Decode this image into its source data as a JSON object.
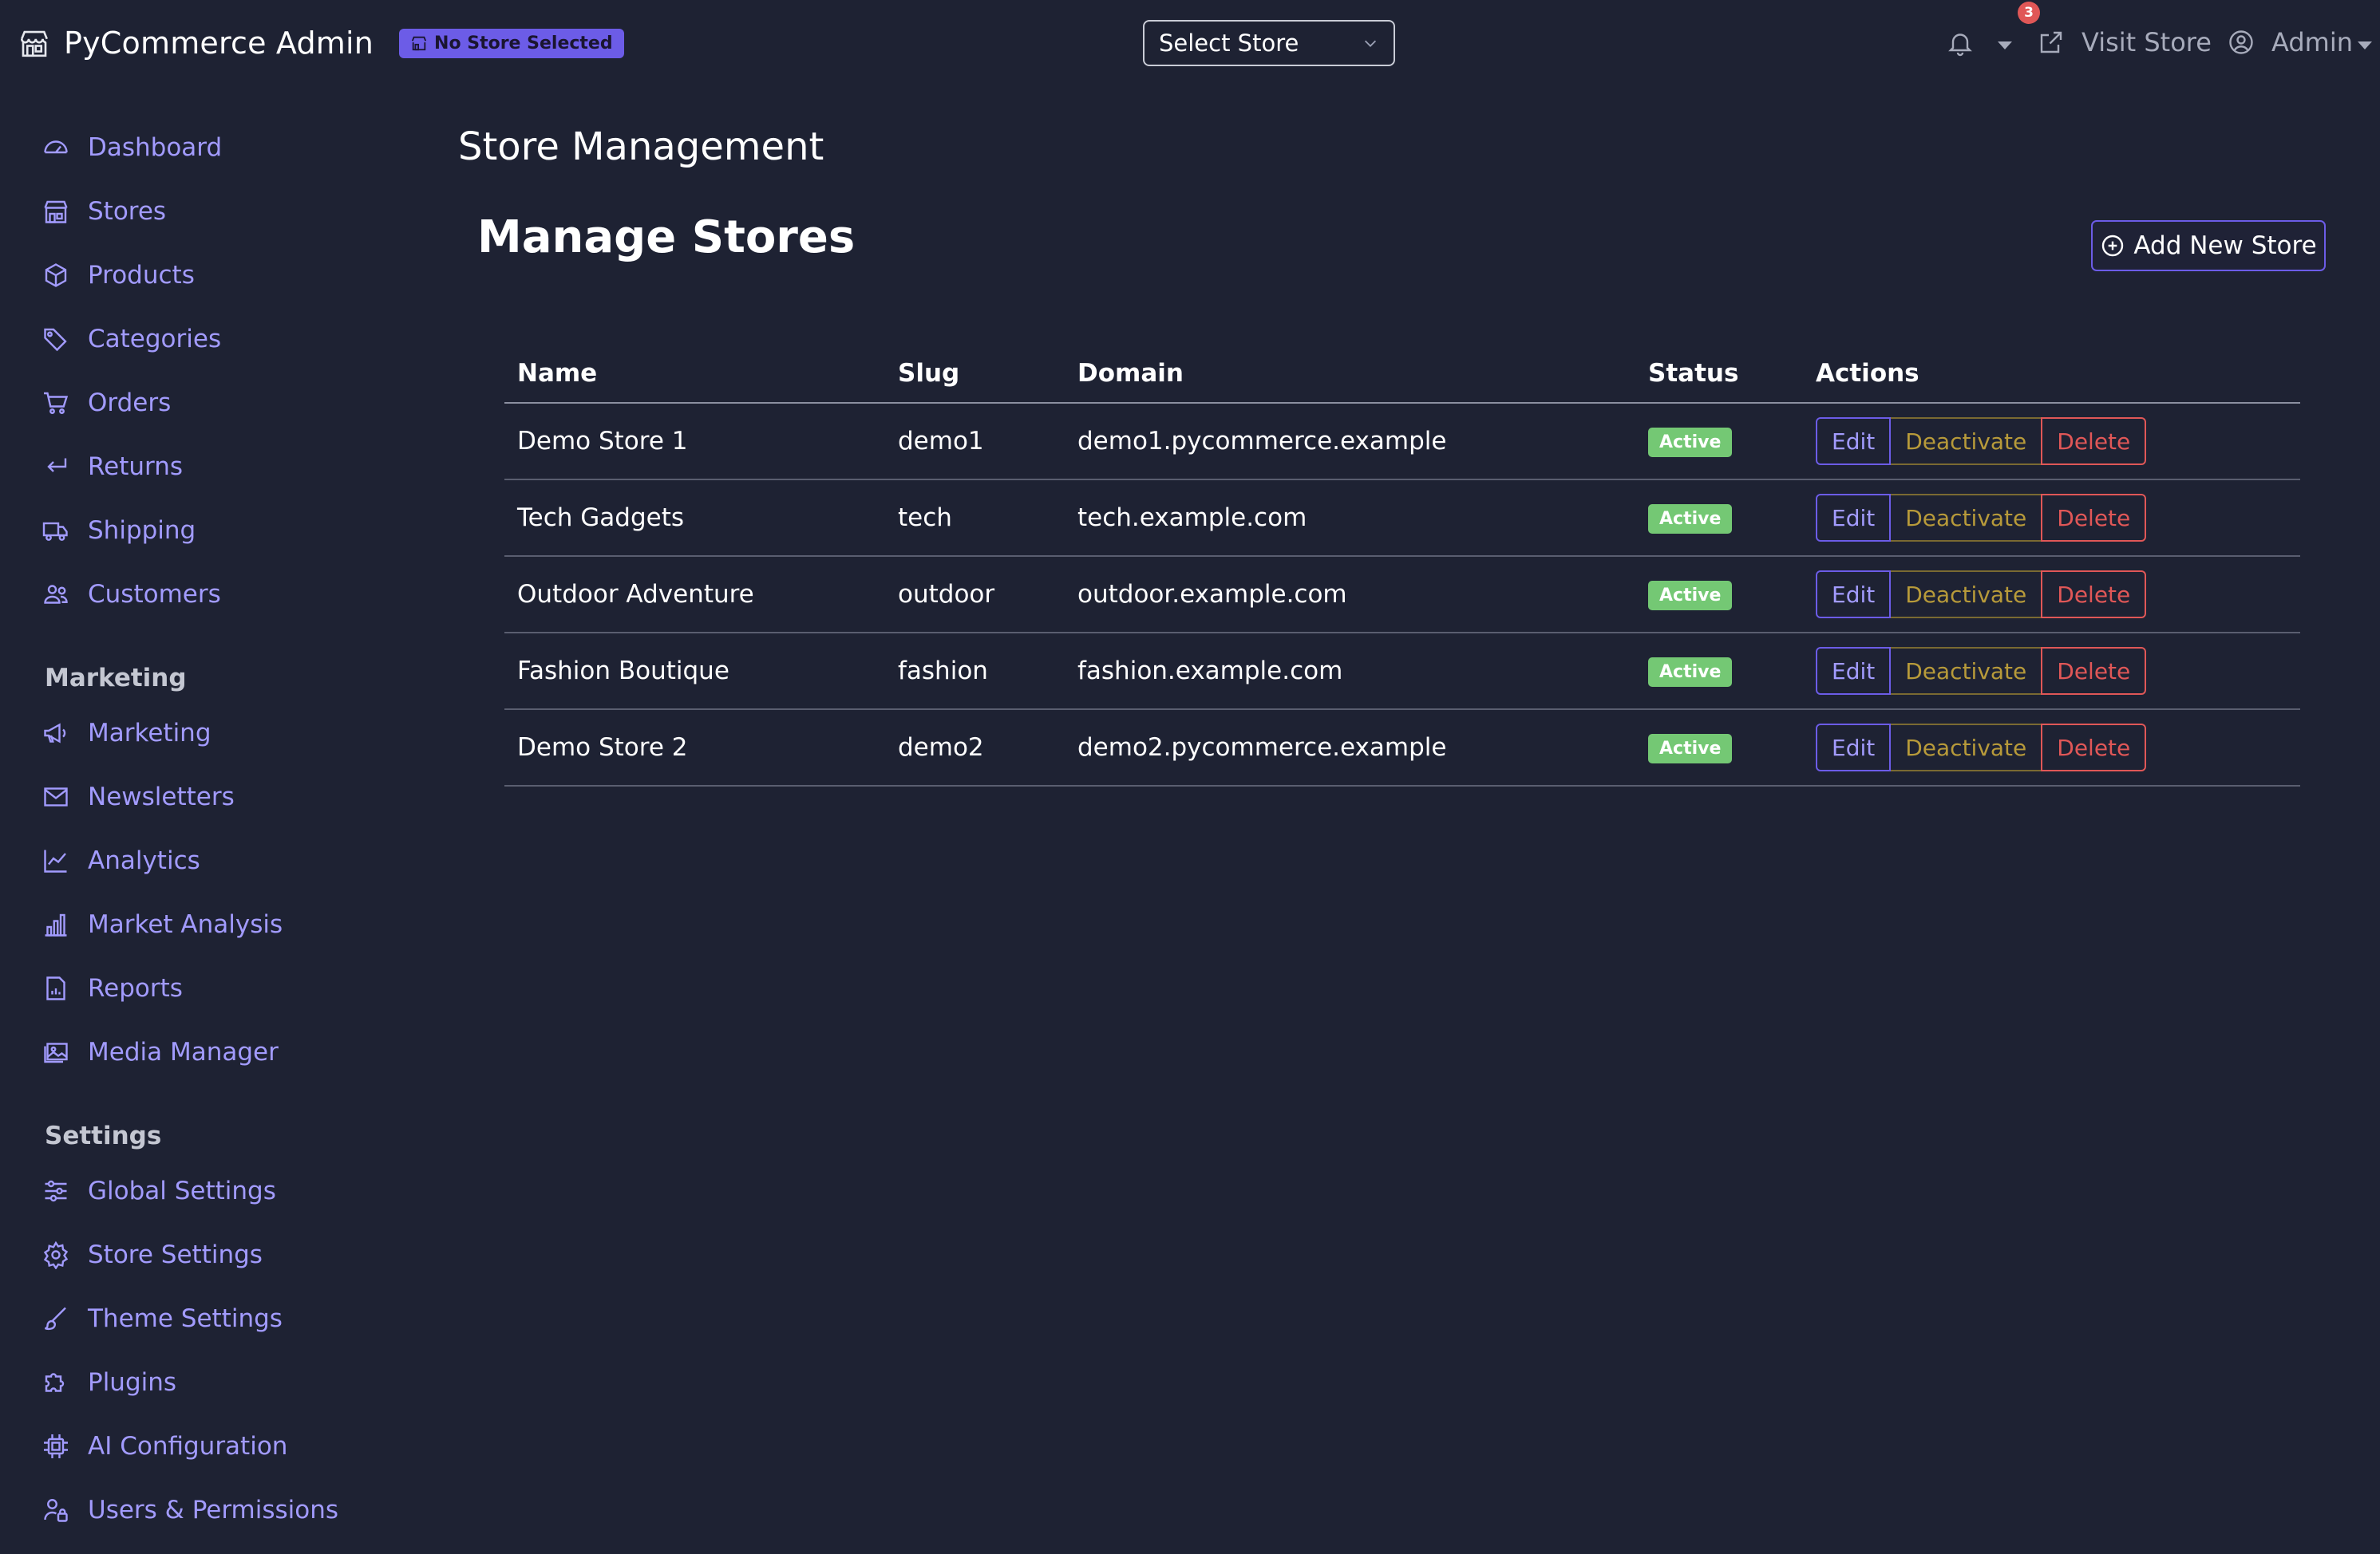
{
  "app": {
    "title": "PyCommerce Admin",
    "store_badge": "No Store Selected",
    "store_select": "Select Store",
    "notification_count": "3",
    "visit_store": "Visit Store",
    "user": "Admin"
  },
  "sidebar": {
    "main_items": [
      {
        "label": "Dashboard",
        "icon": "gauge-icon"
      },
      {
        "label": "Stores",
        "icon": "shop-icon"
      },
      {
        "label": "Products",
        "icon": "box-icon"
      },
      {
        "label": "Categories",
        "icon": "tags-icon"
      },
      {
        "label": "Orders",
        "icon": "cart-icon"
      },
      {
        "label": "Returns",
        "icon": "return-arrow-icon"
      },
      {
        "label": "Shipping",
        "icon": "truck-icon"
      },
      {
        "label": "Customers",
        "icon": "people-icon"
      }
    ],
    "marketing_heading": "Marketing",
    "marketing_items": [
      {
        "label": "Marketing",
        "icon": "megaphone-icon"
      },
      {
        "label": "Newsletters",
        "icon": "envelope-icon"
      },
      {
        "label": "Analytics",
        "icon": "line-graph-icon"
      },
      {
        "label": "Market Analysis",
        "icon": "bar-chart-icon"
      },
      {
        "label": "Reports",
        "icon": "report-file-icon"
      },
      {
        "label": "Media Manager",
        "icon": "images-icon"
      }
    ],
    "settings_heading": "Settings",
    "settings_items": [
      {
        "label": "Global Settings",
        "icon": "sliders-icon"
      },
      {
        "label": "Store Settings",
        "icon": "gear-icon"
      },
      {
        "label": "Theme Settings",
        "icon": "brush-icon"
      },
      {
        "label": "Plugins",
        "icon": "puzzle-icon"
      },
      {
        "label": "AI Configuration",
        "icon": "cpu-icon"
      },
      {
        "label": "Users & Permissions",
        "icon": "person-lock-icon"
      }
    ]
  },
  "main": {
    "page_title": "Store Management",
    "card_title": "Manage Stores",
    "add_button": "Add New Store",
    "table": {
      "headers": [
        "Name",
        "Slug",
        "Domain",
        "Status",
        "Actions"
      ],
      "rows": [
        {
          "name": "Demo Store 1",
          "slug": "demo1",
          "domain": "demo1.pycommerce.example",
          "status": "Active"
        },
        {
          "name": "Tech Gadgets",
          "slug": "tech",
          "domain": "tech.example.com",
          "status": "Active"
        },
        {
          "name": "Outdoor Adventure",
          "slug": "outdoor",
          "domain": "outdoor.example.com",
          "status": "Active"
        },
        {
          "name": "Fashion Boutique",
          "slug": "fashion",
          "domain": "fashion.example.com",
          "status": "Active"
        },
        {
          "name": "Demo Store 2",
          "slug": "demo2",
          "domain": "demo2.pycommerce.example",
          "status": "Active"
        }
      ],
      "actions": {
        "edit": "Edit",
        "deactivate": "Deactivate",
        "delete": "Delete"
      }
    }
  },
  "colors": {
    "background": "#1e2233",
    "accent": "#6c5ce7",
    "link": "#a29bfe",
    "active": "#74c874",
    "warning": "#b79a3a",
    "danger": "#e05757"
  }
}
